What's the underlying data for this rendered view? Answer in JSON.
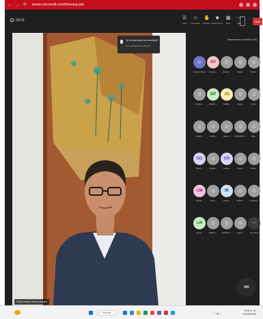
{
  "browser": {
    "address": "teams.microsoft.com/l/meetup-join"
  },
  "meeting": {
    "timer": "00:03",
    "toolbar": [
      {
        "name": "chat",
        "icon": "☰",
        "label": "Chat"
      },
      {
        "name": "people",
        "icon": "☺",
        "label": "Personas"
      },
      {
        "name": "raise-hand",
        "icon": "✋",
        "label": "Levantar"
      },
      {
        "name": "react",
        "icon": "☻",
        "label": "Reacciones"
      },
      {
        "name": "view",
        "icon": "▦",
        "label": "Vista"
      },
      {
        "name": "more",
        "icon": "⋯",
        "label": "Más"
      }
    ],
    "leave_label": "Salir"
  },
  "toast": {
    "title": "Se ha silenciado su micrófono",
    "subtitle": "Otro participante lo silenció"
  },
  "speaker": {
    "name_tag": "Fredy Andrés Herrera Duarte"
  },
  "panel": {
    "header": "Personas en la reunión (53)",
    "tiles": [
      {
        "initials": "",
        "label": "Gestión Beyo",
        "color": "#6f74c9",
        "text": "#ffffff"
      },
      {
        "initials": "AV",
        "label": "Andrea...",
        "color": "#f1c6c6",
        "text": "#a4262c"
      },
      {
        "initials": "",
        "label": "Andrés...",
        "color": "#9e9e9e",
        "text": "#ffffff"
      },
      {
        "initials": "",
        "label": "Ángel...",
        "color": "#9e9e9e",
        "text": "#ffffff"
      },
      {
        "initials": "",
        "label": "Carlos...",
        "color": "#9e9e9e",
        "text": "#ffffff"
      },
      {
        "initials": "",
        "label": "Nelson...",
        "color": "#9e9e9e",
        "text": "#ffffff"
      },
      {
        "initials": "DP",
        "label": "DIEGO...",
        "color": "#c9ecc4",
        "text": "#107c10"
      },
      {
        "initials": "JG",
        "label": "JAIME...",
        "color": "#fff0b3",
        "text": "#986f0b"
      },
      {
        "initials": "",
        "label": "Jorge...",
        "color": "#9e9e9e",
        "text": "#ffffff"
      },
      {
        "initials": "",
        "label": "Lucía...",
        "color": "#9e9e9e",
        "text": "#ffffff"
      },
      {
        "initials": "",
        "label": "Julián...",
        "color": "#9e9e9e",
        "text": "#ffffff"
      },
      {
        "initials": "",
        "label": "LUISA...",
        "color": "#9e9e9e",
        "text": "#ffffff"
      },
      {
        "initials": "",
        "label": "María...",
        "color": "#9e9e9e",
        "text": "#ffffff"
      },
      {
        "initials": "",
        "label": "ROSARIO...",
        "color": "#9e9e9e",
        "text": "#ffffff"
      },
      {
        "initials": "",
        "label": "Sara...",
        "color": "#9e9e9e",
        "text": "#ffffff"
      },
      {
        "initials": "GG",
        "label": "GINA...",
        "color": "#d8d4f2",
        "text": "#5c4ec2"
      },
      {
        "initials": "",
        "label": "Yamile...",
        "color": "#9e9e9e",
        "text": "#ffffff"
      },
      {
        "initials": "GR",
        "label": "Gloria...",
        "color": "#d8d4f2",
        "text": "#5c4ec2"
      },
      {
        "initials": "",
        "label": "Laura...",
        "color": "#9e9e9e",
        "text": "#ffffff"
      },
      {
        "initials": "",
        "label": "Pablo...",
        "color": "#9e9e9e",
        "text": "#ffffff"
      },
      {
        "initials": "CM",
        "label": "camila...",
        "color": "#f2c4df",
        "text": "#a4266f"
      },
      {
        "initials": "",
        "label": "Lucía...",
        "color": "#9e9e9e",
        "text": "#ffffff"
      },
      {
        "initials": "IR",
        "label": "Isabel...",
        "color": "#cfe3f5",
        "text": "#0f548c"
      },
      {
        "initials": "",
        "label": "Daniel...",
        "color": "#9e9e9e",
        "text": "#ffffff"
      },
      {
        "initials": "",
        "label": "Carolina...",
        "color": "#9e9e9e",
        "text": "#ffffff"
      },
      {
        "initials": "LN",
        "label": "Laura...",
        "color": "#c9ecc4",
        "text": "#107c10"
      },
      {
        "initials": "",
        "label": "DIEGO...",
        "color": "#9e9e9e",
        "text": "#ffffff"
      },
      {
        "initials": "",
        "label": "MARCO...",
        "color": "#9e9e9e",
        "text": "#ffffff"
      },
      {
        "initials": "",
        "label": "Nancy...",
        "color": "#9e9e9e",
        "text": "#ffffff"
      },
      {
        "initials": "···",
        "label": "Ver todos",
        "color": "#3a3a3a",
        "text": "#e0e0e0"
      }
    ],
    "rr_initials": "RR"
  },
  "taskbar": {
    "search": "Buscar",
    "time": "9:58 a. m.",
    "date": "13/06/2024",
    "apps": [
      "#1e6fd9",
      "#2b88d8",
      "#f7b500",
      "#0f9d58",
      "#e74c3c",
      "#6264a7",
      "#d13438",
      "#00a4ef"
    ]
  },
  "colors": {
    "accent_red": "#c50f1f",
    "meeting_dark": "#1f1f1f",
    "leave_red": "#d13438"
  }
}
